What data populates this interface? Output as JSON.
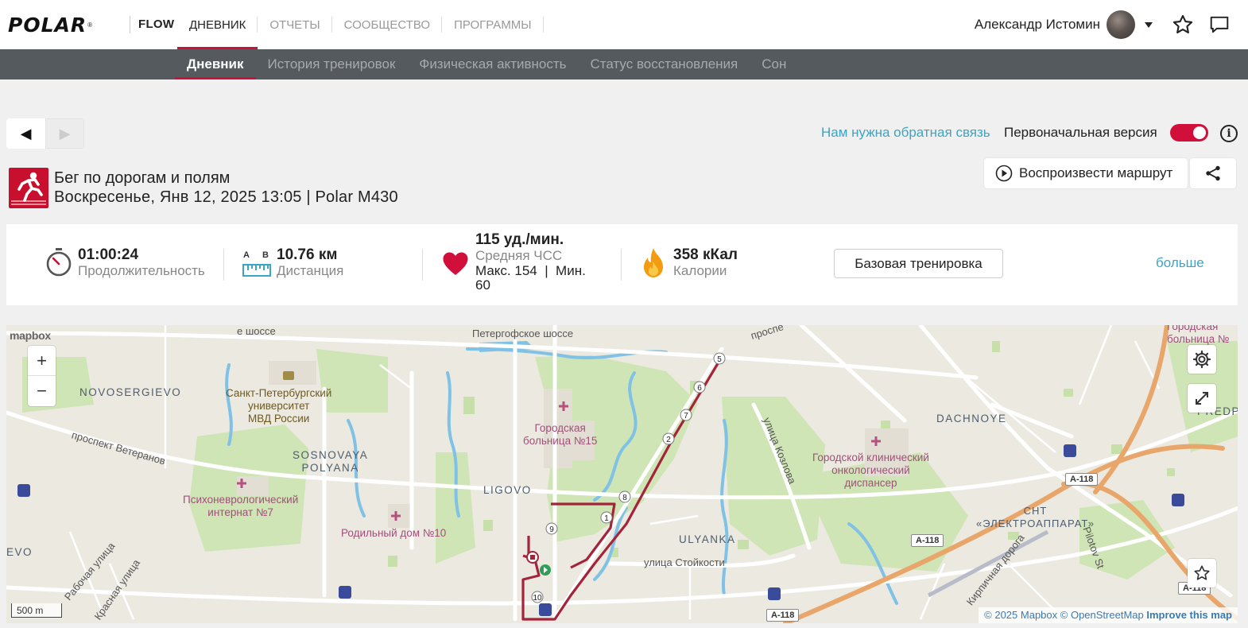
{
  "brand": {
    "logo": "POLAR",
    "product": "FLOW"
  },
  "main_nav": [
    {
      "label": "ДНЕВНИК",
      "active": true
    },
    {
      "label": "ОТЧЕТЫ",
      "active": false
    },
    {
      "label": "СООБЩЕСТВО",
      "active": false
    },
    {
      "label": "ПРОГРАММЫ",
      "active": false
    }
  ],
  "user": {
    "name": "Александр Истомин"
  },
  "sub_nav": [
    {
      "label": "Дневник",
      "active": true
    },
    {
      "label": "История тренировок",
      "active": false
    },
    {
      "label": "Физическая активность",
      "active": false
    },
    {
      "label": "Статус восстановления",
      "active": false
    },
    {
      "label": "Сон",
      "active": false
    }
  ],
  "controls": {
    "prev_glyph": "◀",
    "next_glyph": "▶",
    "feedback_link": "Нам нужна обратная связь",
    "original_version_label": "Первоначальная версия",
    "original_version_on": true,
    "info_glyph": "i"
  },
  "session": {
    "sport": "Бег по дорогам и полям",
    "datetime_device": "Воскресенье, Янв 12, 2025 13:05 | Polar M430",
    "replay_button": "Воспроизвести маршрут"
  },
  "summary": {
    "duration": {
      "value": "01:00:24",
      "label": "Продолжительность"
    },
    "distance": {
      "value": "10.76 км",
      "label": "Дистанция",
      "icon_a": "A",
      "icon_b": "B"
    },
    "heart_rate": {
      "value": "115 уд./мин.",
      "label": "Средняя ЧСС",
      "minmax_line1": "Макс. 154  |  Мин.",
      "minmax_line2": "60"
    },
    "calories": {
      "value": "358 кКал",
      "label": "Калории"
    },
    "basic_training_button": "Базовая тренировка",
    "more_link": "больше"
  },
  "map": {
    "logo": "mapbox",
    "zoom_in": "+",
    "zoom_out": "−",
    "scale": "500 m",
    "attribution": {
      "copyright": "© 2025 Mapbox",
      "osm": "OpenStreetMap",
      "improve": "Improve this map"
    },
    "labels": {
      "peterhof_highway": "Петергофское шоссе",
      "highway_left": "е шоссе",
      "prospekt_top": "проспе",
      "city_hospital_top": "Городская\nбольница №",
      "novosergievo": "NOVOSERGIEVO",
      "university": "Санкт-Петербургский\nуниверситет\nМВД России",
      "city_hospital_15": "Городская\nбольница №15",
      "veteranov": "проспект Ветеранов",
      "sosnovaya": "SOSNOVAYA\nPOLYANA",
      "ligovo": "LIGOVO",
      "kozlova": "улица Козлова",
      "dachnoye": "DACHNOYE",
      "oncology": "Городской клинический\nонкологический\nдиспансер",
      "psycho": "Психоневрологический\nинтернат №7",
      "maternity": "Родильный дом №10",
      "ulyanka": "ULYANKA",
      "stoikosti": "улица Стойкости",
      "elektroapparat": "СНТ\n«ЭЛЕКТРОАППАРАТ»",
      "rabochaya": "Рабочая улица",
      "krasnaya": "Красная улица",
      "kirpichnaya": "Кирпичная дорога",
      "pilotov": "Pilotov St",
      "evo": "EVO",
      "predpor": "PREDPOR",
      "a118_1": "A-118",
      "a118_2": "A-118",
      "a118_3": "A-118",
      "a118_4": "A-118"
    },
    "km_markers": [
      "1",
      "2",
      "5",
      "6",
      "7",
      "8",
      "9",
      "10"
    ],
    "route_color": "#a3243b"
  },
  "colors": {
    "accent": "#d0103a",
    "link": "#3aa5c4",
    "subnav_bg": "#555a5e"
  }
}
